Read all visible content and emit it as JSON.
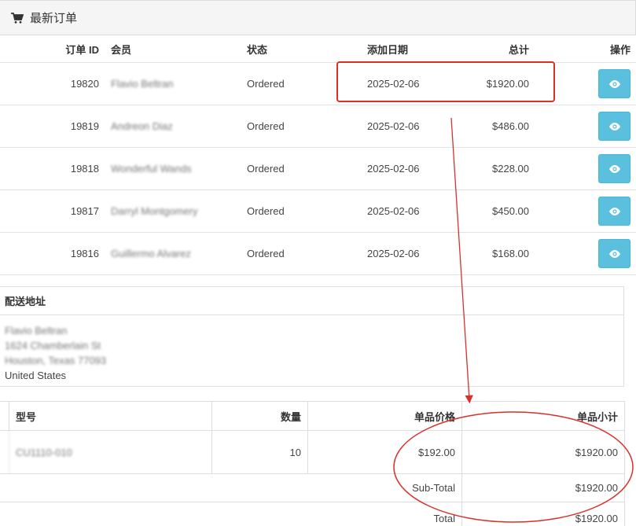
{
  "panel": {
    "title": "最新订单",
    "icon": "cart-icon"
  },
  "orders": {
    "headers": {
      "id": "订单 ID",
      "member": "会员",
      "status": "状态",
      "date": "添加日期",
      "total": "总计",
      "action": "操作"
    },
    "rows": [
      {
        "id": "19820",
        "member": "Flavio Beltran",
        "status": "Ordered",
        "date": "2025-02-06",
        "total": "$1920.00"
      },
      {
        "id": "19819",
        "member": "Andreon Diaz",
        "status": "Ordered",
        "date": "2025-02-06",
        "total": "$486.00"
      },
      {
        "id": "19818",
        "member": "Wonderful Wands",
        "status": "Ordered",
        "date": "2025-02-06",
        "total": "$228.00"
      },
      {
        "id": "19817",
        "member": "Darryl Montgomery",
        "status": "Ordered",
        "date": "2025-02-06",
        "total": "$450.00"
      },
      {
        "id": "19816",
        "member": "Guillermo Alvarez",
        "status": "Ordered",
        "date": "2025-02-06",
        "total": "$168.00"
      }
    ],
    "view_icon": "eye-icon"
  },
  "shipping": {
    "title": "配送地址",
    "lines": [
      "Flavio Beltran",
      "1624 Chamberlain St",
      "Houston, Texas 77093",
      "United States"
    ]
  },
  "items": {
    "headers": {
      "model": "型号",
      "qty": "数量",
      "price": "单品价格",
      "subtotal": "单品小计"
    },
    "line": {
      "model": "CU1110-010",
      "qty": "10",
      "price": "$192.00",
      "subtotal": "$1920.00"
    },
    "subtotal_label": "Sub-Total",
    "subtotal_value": "$1920.00",
    "total_label": "Total",
    "total_value": "$1920.00"
  },
  "colors": {
    "highlight": "#d9302c",
    "view_button": "#5bc0de"
  }
}
